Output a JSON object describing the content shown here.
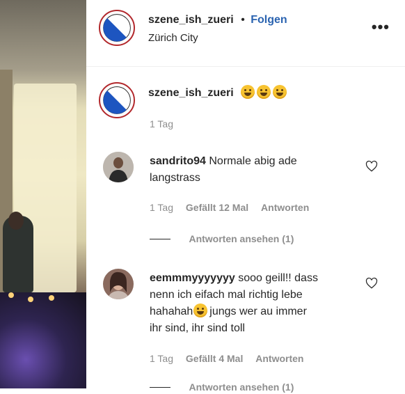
{
  "post": {
    "username": "szene_ish_zueri",
    "follow_separator": "•",
    "follow_label": "Folgen",
    "location": "Zürich City",
    "more_icon": "more-options-icon"
  },
  "caption": {
    "username": "szene_ish_zueri",
    "emojis": [
      "rolling-on-floor-laughing-emoji",
      "rolling-on-floor-laughing-emoji",
      "rolling-on-floor-laughing-emoji"
    ],
    "time": "1 Tag"
  },
  "comments": [
    {
      "username": "sandrito94",
      "text": "Normale abig ade",
      "text_line2": "langstrass",
      "time": "1 Tag",
      "likes": "Gefällt 12 Mal",
      "reply": "Antworten",
      "view_replies": "Antworten ansehen (1)"
    },
    {
      "username": "eemmmyyyyyyy",
      "text": "sooo geill!! dass",
      "text_line2": "nenn ich eifach mal richtig lebe",
      "text_line3a": "hahahah",
      "text_line3b": "jungs wer au immer",
      "text_line4": "ihr sind, ihr sind toll",
      "time": "1 Tag",
      "likes": "Gefällt 4 Mal",
      "reply": "Antworten",
      "view_replies": "Antworten ansehen (1)"
    }
  ],
  "colors": {
    "follow": "#2a63b0",
    "text": "#262626",
    "meta": "#8e8e8e",
    "logo_ring": "#b2282c",
    "logo_blue": "#1d55c0"
  }
}
